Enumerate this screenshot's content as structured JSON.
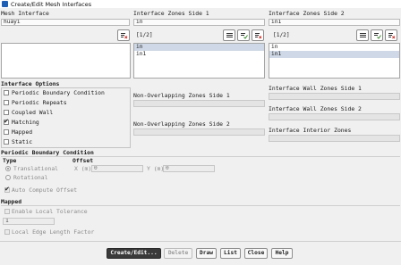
{
  "window": {
    "title": "Create/Edit Mesh Interfaces"
  },
  "mesh_interface": {
    "label": "Mesh Interface",
    "value": "huayi"
  },
  "side1": {
    "label": "Interface Zones Side 1",
    "filter_value": "in",
    "page": "[1/2]",
    "items": [
      "in",
      "in1"
    ],
    "selected": "in"
  },
  "side2": {
    "label": "Interface Zones Side 2",
    "filter_value": "in1",
    "page": "[1/2]",
    "items": [
      "in",
      "in1"
    ],
    "selected": "in1"
  },
  "interface_options": {
    "label": "Interface Options",
    "items": [
      {
        "label": "Periodic Boundary Condition",
        "checked": false
      },
      {
        "label": "Periodic Repeats",
        "checked": false
      },
      {
        "label": "Coupled Wall",
        "checked": false
      },
      {
        "label": "Matching",
        "checked": true
      },
      {
        "label": "Mapped",
        "checked": false
      },
      {
        "label": "Static",
        "checked": false
      }
    ]
  },
  "non_overlap_1": {
    "label": "Non-Overlapping Zones Side 1"
  },
  "non_overlap_2": {
    "label": "Non-Overlapping Zones Side 2"
  },
  "wall_1": {
    "label": "Interface Wall Zones Side 1"
  },
  "wall_2": {
    "label": "Interface Wall Zones Side 2"
  },
  "interior": {
    "label": "Interface Interior Zones"
  },
  "periodic": {
    "label": "Periodic Boundary Condition",
    "type_label": "Type",
    "translational": "Translational",
    "rotational": "Rotational",
    "offset_label": "Offset",
    "x_label": "X (m)",
    "x_value": "0",
    "y_label": "Y (m)",
    "y_value": "0",
    "auto_compute": "Auto Compute Offset"
  },
  "mapped": {
    "label": "Mapped",
    "enable_tolerance": "Enable Local Tolerance",
    "tolerance_value": "1",
    "edge_factor": "Local Edge Length Factor"
  },
  "buttons": {
    "create": "Create/Edit...",
    "delete": "Delete",
    "draw": "Draw",
    "list": "List",
    "close": "Close",
    "help": "Help"
  }
}
